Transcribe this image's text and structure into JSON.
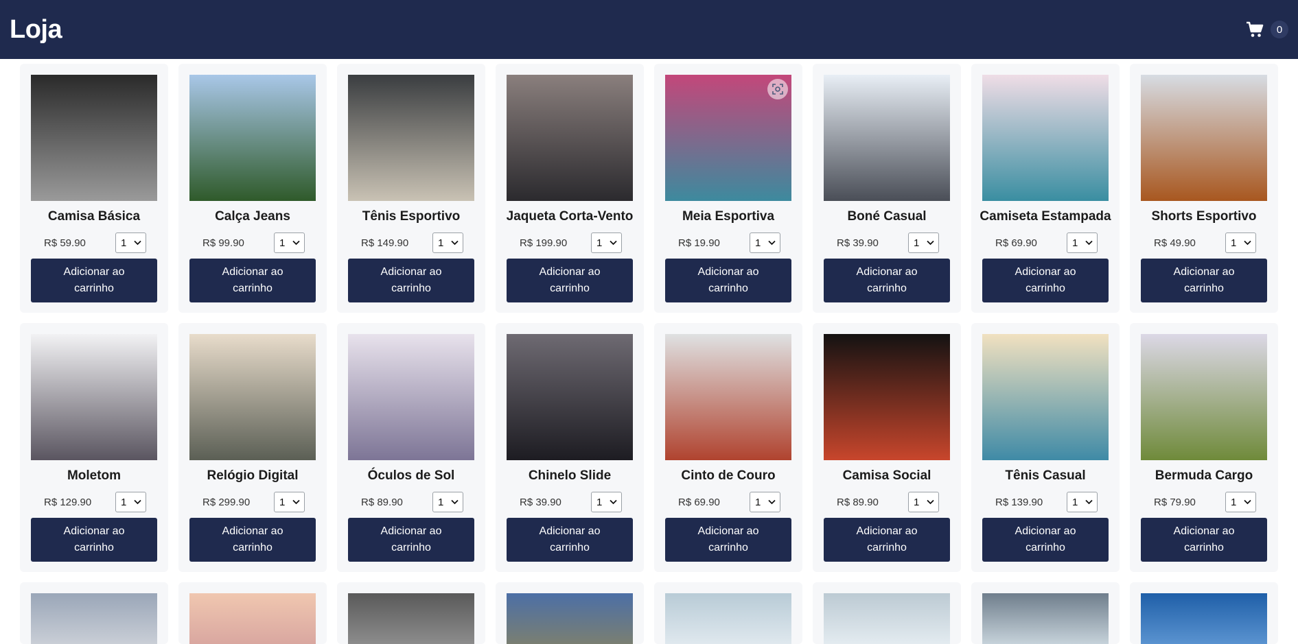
{
  "header": {
    "title": "Loja",
    "cart_count": "0",
    "cart_icon": "shopping-cart-icon"
  },
  "product_action_label": "Adicionar ao carrinho",
  "products": [
    {
      "name": "Camisa Básica",
      "price": "R$ 59.90",
      "qty": "1",
      "photo": "grass-bw",
      "colors": [
        "#2a2a2a",
        "#9a9a9a"
      ]
    },
    {
      "name": "Calça Jeans",
      "price": "R$ 99.90",
      "qty": "1",
      "photo": "mountain-forest",
      "colors": [
        "#a9c7e8",
        "#2f5a2a"
      ]
    },
    {
      "name": "Tênis Esportivo",
      "price": "R$ 149.90",
      "qty": "1",
      "photo": "desk-top-view",
      "colors": [
        "#3a3d40",
        "#c9c2b4"
      ]
    },
    {
      "name": "Jaqueta Corta-Vento",
      "price": "R$ 199.90",
      "qty": "1",
      "photo": "lake-forest",
      "colors": [
        "#8a7f7d",
        "#2b2a2e"
      ]
    },
    {
      "name": "Meia Esportiva",
      "price": "R$ 19.90",
      "qty": "1",
      "photo": "colorful-scarf",
      "colors": [
        "#c3477a",
        "#3d8a9e"
      ]
    },
    {
      "name": "Boné Casual",
      "price": "R$ 39.90",
      "qty": "1",
      "photo": "city-sunlight",
      "colors": [
        "#e8eef5",
        "#4a4e57"
      ]
    },
    {
      "name": "Camiseta Estampada",
      "price": "R$ 69.90",
      "qty": "1",
      "photo": "bridge-pink-sky",
      "colors": [
        "#efdde6",
        "#3a8ea1"
      ]
    },
    {
      "name": "Shorts Esportivo",
      "price": "R$ 49.90",
      "qty": "1",
      "photo": "laptop-wood-desk",
      "colors": [
        "#d7dce3",
        "#a8571f"
      ]
    },
    {
      "name": "Moletom",
      "price": "R$ 129.90",
      "qty": "1",
      "photo": "misty-peak",
      "colors": [
        "#f2f2f4",
        "#5a5560"
      ]
    },
    {
      "name": "Relógio Digital",
      "price": "R$ 299.90",
      "qty": "1",
      "photo": "valley-wall",
      "colors": [
        "#e8dccb",
        "#5b5f55"
      ]
    },
    {
      "name": "Óculos de Sol",
      "price": "R$ 89.90",
      "qty": "1",
      "photo": "snow-figure",
      "colors": [
        "#e8e2ec",
        "#7d7596"
      ]
    },
    {
      "name": "Chinelo Slide",
      "price": "R$ 39.90",
      "qty": "1",
      "photo": "skyscraper-dusk",
      "colors": [
        "#6e6a72",
        "#1d1c22"
      ]
    },
    {
      "name": "Cinto de Couro",
      "price": "R$ 69.90",
      "qty": "1",
      "photo": "bridge-fog",
      "colors": [
        "#dfe1e2",
        "#b0432f"
      ]
    },
    {
      "name": "Camisa Social",
      "price": "R$ 89.90",
      "qty": "1",
      "photo": "red-plant-dark",
      "colors": [
        "#141212",
        "#c8462c"
      ]
    },
    {
      "name": "Tênis Casual",
      "price": "R$ 139.90",
      "qty": "1",
      "photo": "sea-rock",
      "colors": [
        "#f1e1c0",
        "#3f8aa6"
      ]
    },
    {
      "name": "Bermuda Cargo",
      "price": "R$ 79.90",
      "qty": "1",
      "photo": "green-hills",
      "colors": [
        "#dcd8e6",
        "#6f8a3a"
      ]
    }
  ],
  "partial_row_colors": [
    [
      "#9aa6b8",
      "#c9ced6"
    ],
    [
      "#f0c7b0",
      "#d9a7a0"
    ],
    [
      "#5a5a5a",
      "#8c8c8c"
    ],
    [
      "#4c6fa6",
      "#7a7f72"
    ],
    [
      "#b8cbd6",
      "#dfe8ee"
    ],
    [
      "#bccad3",
      "#e3ebf0"
    ],
    [
      "#6f7e8c",
      "#c6d2da"
    ],
    [
      "#1f5fa8",
      "#5a93d0"
    ]
  ]
}
